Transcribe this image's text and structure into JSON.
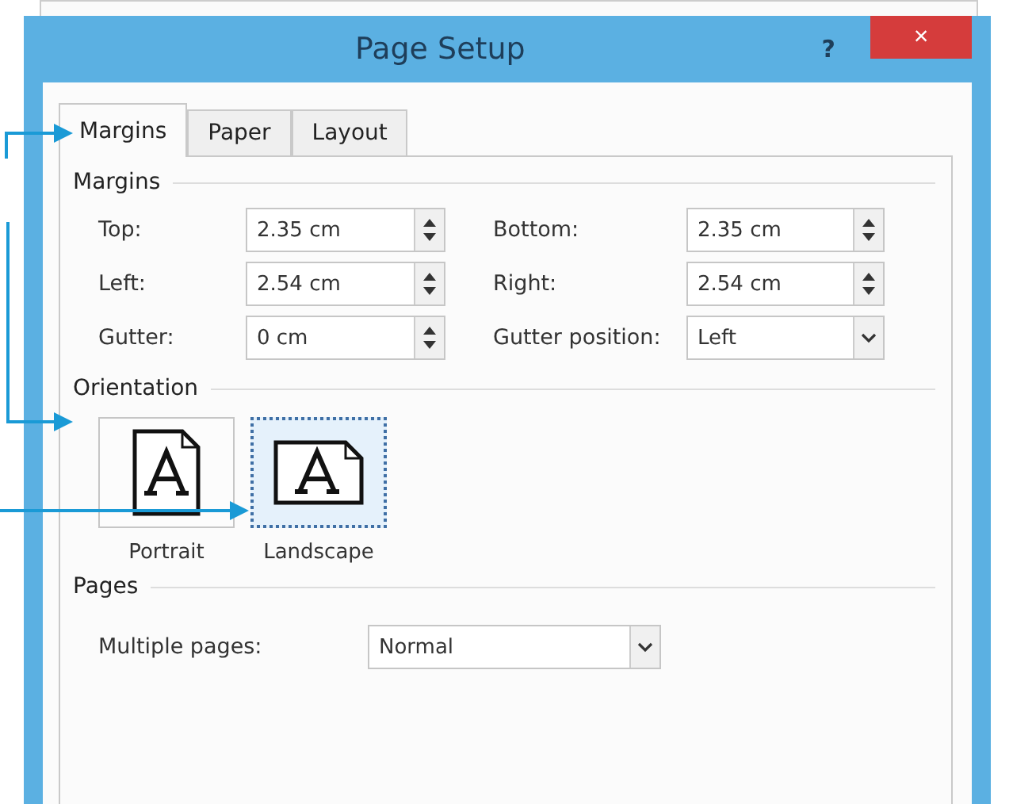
{
  "window": {
    "title": "Page Setup",
    "help": "?",
    "close": "×"
  },
  "tabs": [
    {
      "label": "Margins",
      "selected": true
    },
    {
      "label": "Paper",
      "selected": false
    },
    {
      "label": "Layout",
      "selected": false
    }
  ],
  "margins": {
    "heading": "Margins",
    "fields": [
      {
        "label": "Top:",
        "value": "2.35 cm",
        "kind": "spin"
      },
      {
        "label": "Bottom:",
        "value": "2.35 cm",
        "kind": "spin"
      },
      {
        "label": "Left:",
        "value": "2.54 cm",
        "kind": "spin"
      },
      {
        "label": "Right:",
        "value": "2.54 cm",
        "kind": "spin"
      },
      {
        "label": "Gutter:",
        "value": "0 cm",
        "kind": "spin"
      },
      {
        "label": "Gutter position:",
        "value": "Left",
        "kind": "dropdown"
      }
    ]
  },
  "orientation": {
    "heading": "Orientation",
    "options": [
      {
        "label": "Portrait",
        "kind": "portrait",
        "selected": false
      },
      {
        "label": "Landscape",
        "kind": "landscape",
        "selected": true
      }
    ]
  },
  "pages": {
    "heading": "Pages",
    "label": "Multiple pages:",
    "value": "Normal"
  }
}
